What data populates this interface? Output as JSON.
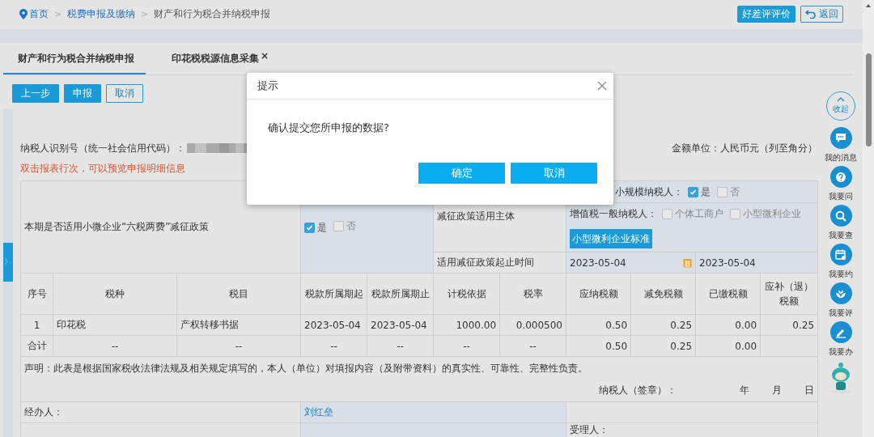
{
  "breadcrumb": [
    {
      "label": "首页",
      "kind": "home"
    },
    {
      "sep": ">",
      "label": "税费申报及缴纳",
      "kind": "link"
    },
    {
      "sep": ">",
      "label": "财产和行为税合并纳税申报",
      "kind": "current"
    }
  ],
  "header_buttons": [
    {
      "label": "好差评评价",
      "kind": "primary"
    },
    {
      "label": "返回",
      "kind": "back"
    }
  ],
  "tabs": [
    {
      "label": "财产和行为税合并纳税申报",
      "selected": true
    },
    {
      "label": "印花税税源信息采集",
      "selected": false,
      "close": "×"
    }
  ],
  "toolbar": [
    {
      "label": "上一步",
      "kind": "primary"
    },
    {
      "label": "申报",
      "kind": "primary"
    },
    {
      "label": "取消",
      "kind": "outline"
    }
  ],
  "sidebar_toggle": "〉",
  "taxpayer_id_label": "纳税人识别号（统一社会信用代码）：",
  "amount_unit": "金额单位：人民币元（列至角分）",
  "hint": "双击报表行次，可以预览申报明细信息",
  "policy": {
    "question": "本期是否适用小微企业“六税两费”减征政策",
    "options": [
      {
        "label": "是",
        "checked": true
      },
      {
        "label": "否",
        "checked": false
      }
    ],
    "subject_label": "减征政策适用主体",
    "small_scale": {
      "label": "小规模纳税人：",
      "options": [
        {
          "label": "是",
          "checked": true
        },
        {
          "label": "否",
          "checked": false
        }
      ]
    },
    "general": {
      "label": "增值税一般纳税人：",
      "options": [
        {
          "label": "个体工商户",
          "checked": false
        },
        {
          "label": "小型微利企业",
          "checked": false
        }
      ]
    },
    "standard_button": "小型微利企业标准",
    "period_label": "适用减征政策起止时间",
    "period_start": "2023-05-04",
    "period_end": "2023-05-04"
  },
  "table": {
    "columns": [
      "序号",
      "税种",
      "税目",
      "税款所属期起",
      "税款所属期止",
      "计税依据",
      "税率",
      "应纳税额",
      "减免税额",
      "已缴税额",
      "应补（退）税额"
    ],
    "rows": [
      {
        "kind": "item",
        "cells": [
          "1",
          "印花税",
          "产权转移书据",
          "2023-05-04",
          "2023-05-04",
          "1000.00",
          "0.000500",
          "0.50",
          "0.25",
          "0.00",
          "0.25"
        ]
      },
      {
        "kind": "total",
        "cells": [
          "合计",
          "--",
          "--",
          "--",
          "--",
          "--",
          "--",
          "0.50",
          "0.25",
          "0.00"
        ]
      }
    ]
  },
  "declaration": "声明：此表是根据国家税收法律法规及相关规定填写的，本人（单位）对填报内容（及附带资料）的真实性、可靠性、完整性负责。",
  "signature": {
    "label": "纳税人（签章）：",
    "year": "年",
    "month": "月",
    "day": "日"
  },
  "agent": {
    "label": "经办人：",
    "value": "刘红垒"
  },
  "acceptor_label": "受理人：",
  "floating": {
    "collapse": "收起",
    "items": [
      {
        "label": "我的消息",
        "kind": "message"
      },
      {
        "label": "我要问",
        "kind": "question"
      },
      {
        "label": "我要查",
        "kind": "search"
      },
      {
        "label": "我要约",
        "kind": "calendar"
      },
      {
        "label": "我要评",
        "kind": "rate"
      },
      {
        "label": "我要办",
        "kind": "edit"
      }
    ]
  },
  "dialog": {
    "title": "提示",
    "message": "确认提交您所申报的数据?",
    "buttons": [
      "确定",
      "取消"
    ]
  }
}
